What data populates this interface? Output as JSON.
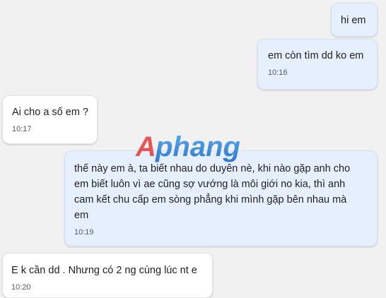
{
  "messages": [
    {
      "direction": "sent",
      "text": "hi em",
      "time": ""
    },
    {
      "direction": "sent",
      "text": "em còn tìm dd ko em",
      "time": "10:16"
    },
    {
      "direction": "received",
      "text": "Ai cho a số em ?",
      "time": "10:17"
    },
    {
      "direction": "sent",
      "text": "thế này em à, ta biết nhau do duyên nè, khi nào gặp anh cho\nem biết luôn vì ae cũng sợ vướng là môi giới no kia, thì anh\ncam kết chu cấp em sòng phẳng khi mình gặp bên nhau mà\nem",
      "time": "10:19"
    },
    {
      "direction": "received",
      "text": "E k cần dd . Nhưng có 2 ng cùng lúc nt e",
      "time": "10:20"
    }
  ],
  "watermark": {
    "text": "Aphang",
    "colors": {
      "accent": "#e23b3b",
      "main": "#1e88e5"
    }
  },
  "colors": {
    "background": "#f1f1f2",
    "sent_bubble": "#e6effd",
    "received_bubble": "#ffffff"
  }
}
